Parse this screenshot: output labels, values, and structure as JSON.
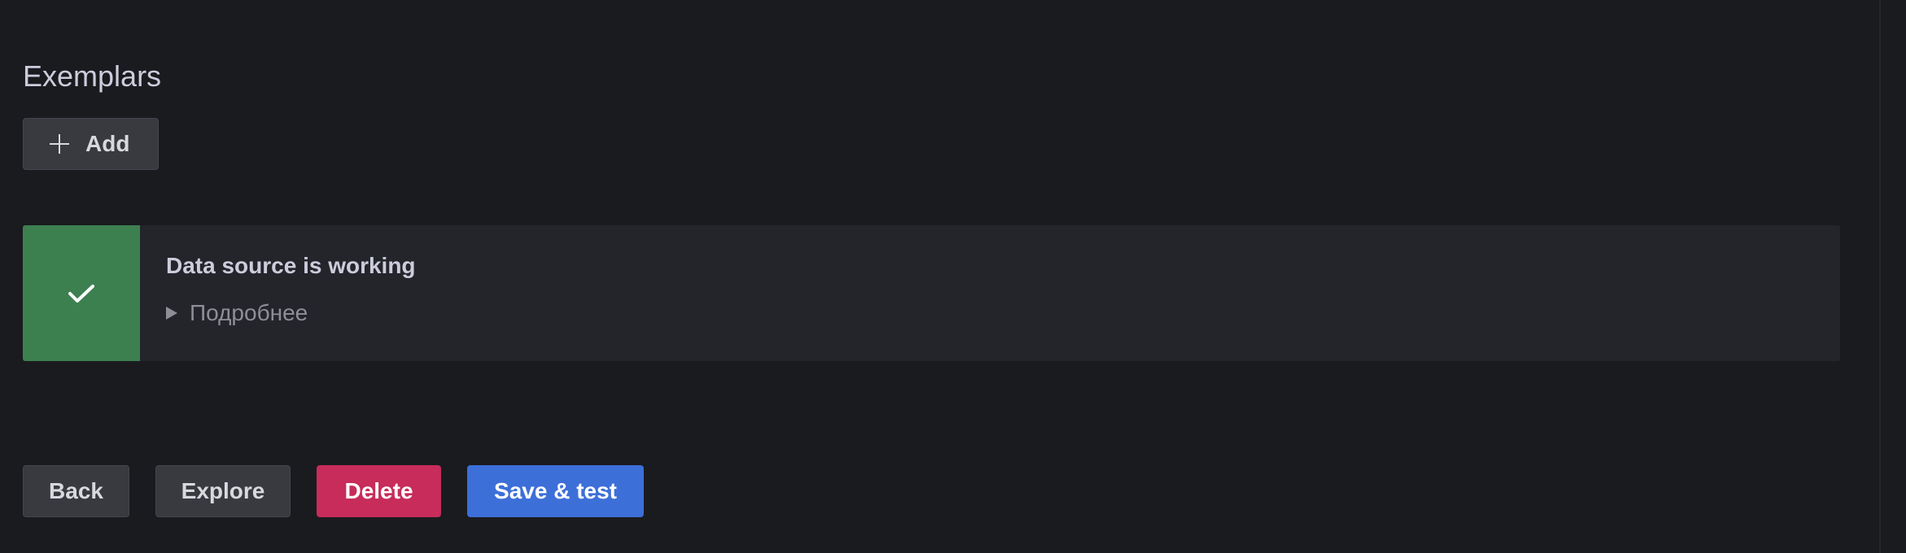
{
  "exemplars": {
    "title": "Exemplars",
    "add_label": "Add",
    "add_icon": "plus-icon"
  },
  "status_alert": {
    "title": "Data source is working",
    "details_label": "Подробнее",
    "icon": "check-icon",
    "color": "#3d8050"
  },
  "footer": {
    "back_label": "Back",
    "explore_label": "Explore",
    "delete_label": "Delete",
    "save_label": "Save & test",
    "delete_color": "#c72c5b",
    "save_color": "#3d6fd8"
  }
}
